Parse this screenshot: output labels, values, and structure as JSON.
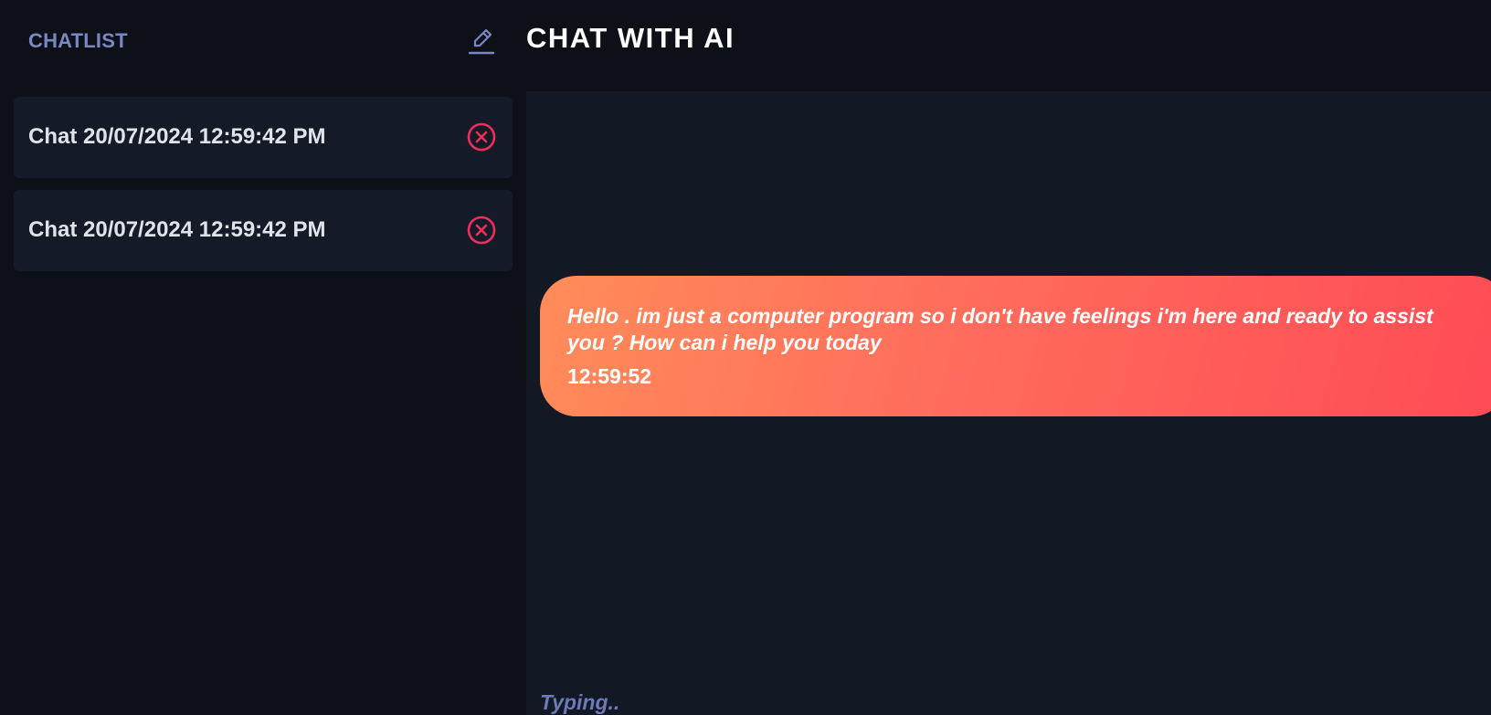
{
  "sidebar": {
    "title": "CHATLIST",
    "new_chat_icon": "pencil-icon",
    "items": [
      {
        "label": "Chat 20/07/2024 12:59:42 PM",
        "delete_icon": "close-circle-icon"
      },
      {
        "label": "Chat 20/07/2024 12:59:42 PM",
        "delete_icon": "close-circle-icon"
      }
    ]
  },
  "header": {
    "title": "CHAT WITH AI"
  },
  "chat": {
    "messages": [
      {
        "text": "Hello . im just a computer program so i don't have feelings i'm here and ready to assist you ? How can i help you today",
        "time": "12:59:52"
      }
    ],
    "typing_status": "Typing.."
  },
  "colors": {
    "background": "#0d1017",
    "panel": "#141a28",
    "accent_label": "#7a87c4",
    "delete_icon": "#e8305a",
    "bubble_gradient_start": "#ff8c5a",
    "bubble_gradient_end": "#ff4a55"
  }
}
